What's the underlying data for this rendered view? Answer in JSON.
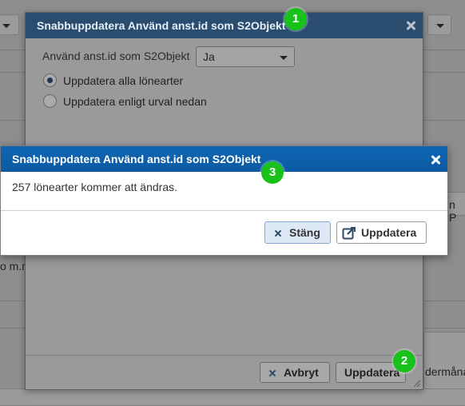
{
  "background": {
    "text_left_fragment": "o m.m",
    "text_right_fragment_1": "n P",
    "text_right_fragment_2": "dermåna"
  },
  "dialog1": {
    "title": "Snabbuppdatera Använd anst.id som S2Objekt",
    "field_label": "Använd anst.id som S2Objekt",
    "select_value": "Ja",
    "radio_options": [
      "Uppdatera alla lönearter",
      "Uppdatera enligt urval nedan"
    ],
    "selected_radio": 0,
    "cancel_label": "Avbryt",
    "update_label": "Uppdatera",
    "close_icon": "close-icon"
  },
  "dialog3": {
    "title": "Snabbuppdatera Använd anst.id som S2Objekt",
    "message": "257 lönearter kommer att ändras.",
    "close_label": "Stäng",
    "update_label": "Uppdatera"
  },
  "markers": [
    "1",
    "2",
    "3"
  ],
  "colors": {
    "marker_green": "#19c21a",
    "active_header_blue": "#0f66b4",
    "dimmed_header": "#2a4d6f"
  }
}
